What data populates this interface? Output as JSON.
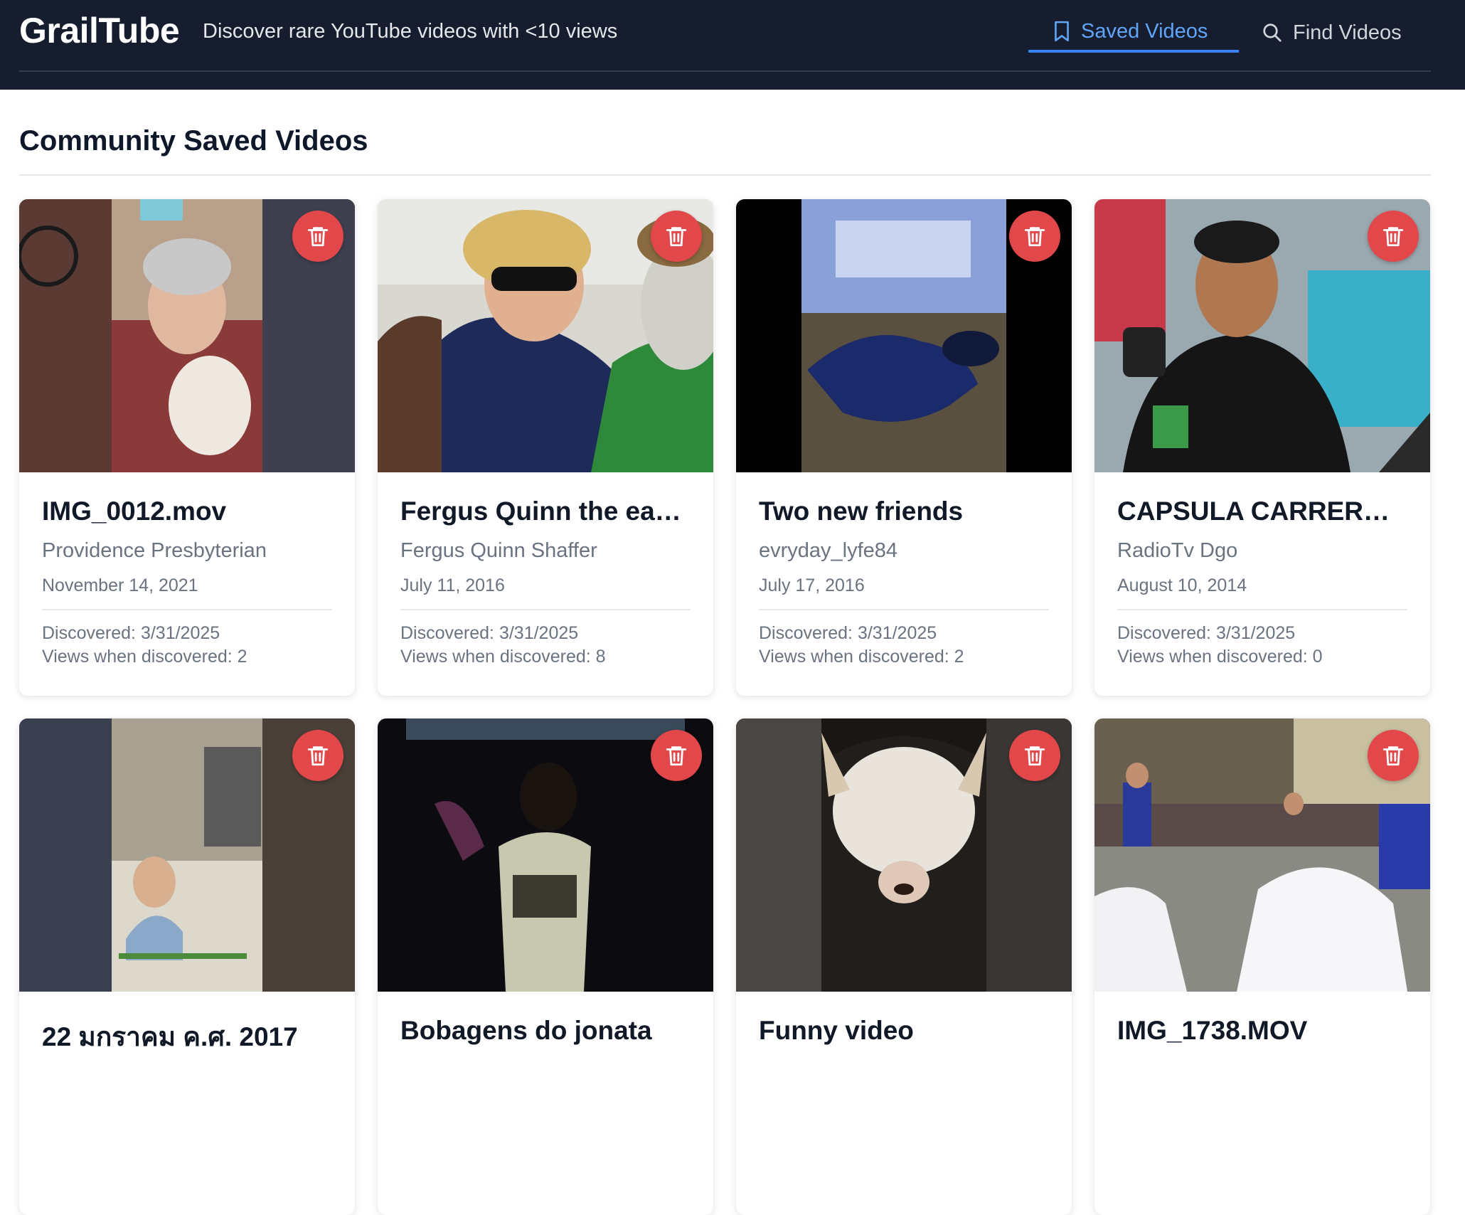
{
  "header": {
    "brand": "GrailTube",
    "tagline": "Discover rare YouTube videos with <10 views",
    "tabs": [
      {
        "label": "Saved Videos",
        "icon": "bookmark-icon",
        "active": true
      },
      {
        "label": "Find Videos",
        "icon": "search-icon",
        "active": false
      }
    ]
  },
  "main": {
    "title": "Community Saved Videos",
    "videos": [
      {
        "title": "IMG_0012.mov",
        "channel": "Providence Presbyterian",
        "date": "November 14, 2021",
        "discovered": "Discovered: 3/31/2025",
        "views": "Views when discovered: 2"
      },
      {
        "title": "Fergus Quinn the earl...",
        "channel": "Fergus Quinn Shaffer",
        "date": "July 11, 2016",
        "discovered": "Discovered: 3/31/2025",
        "views": "Views when discovered: 8"
      },
      {
        "title": "Two new friends",
        "channel": "evryday_lyfe84",
        "date": "July 17, 2016",
        "discovered": "Discovered: 3/31/2025",
        "views": "Views when discovered: 2"
      },
      {
        "title": "CAPSULA CARRERA ...",
        "channel": "RadioTv Dgo",
        "date": "August 10, 2014",
        "discovered": "Discovered: 3/31/2025",
        "views": "Views when discovered: 0"
      },
      {
        "title": "22 มกราคม ค.ศ. 2017",
        "channel": "",
        "date": "",
        "discovered": "",
        "views": ""
      },
      {
        "title": "Bobagens do jonata",
        "channel": "",
        "date": "",
        "discovered": "",
        "views": ""
      },
      {
        "title": "Funny video",
        "channel": "",
        "date": "",
        "discovered": "",
        "views": ""
      },
      {
        "title": "IMG_1738.MOV",
        "channel": "",
        "date": "",
        "discovered": "",
        "views": ""
      }
    ]
  },
  "colors": {
    "header_bg": "#161d2e",
    "accent": "#60a5fa",
    "delete": "#e2474a"
  }
}
